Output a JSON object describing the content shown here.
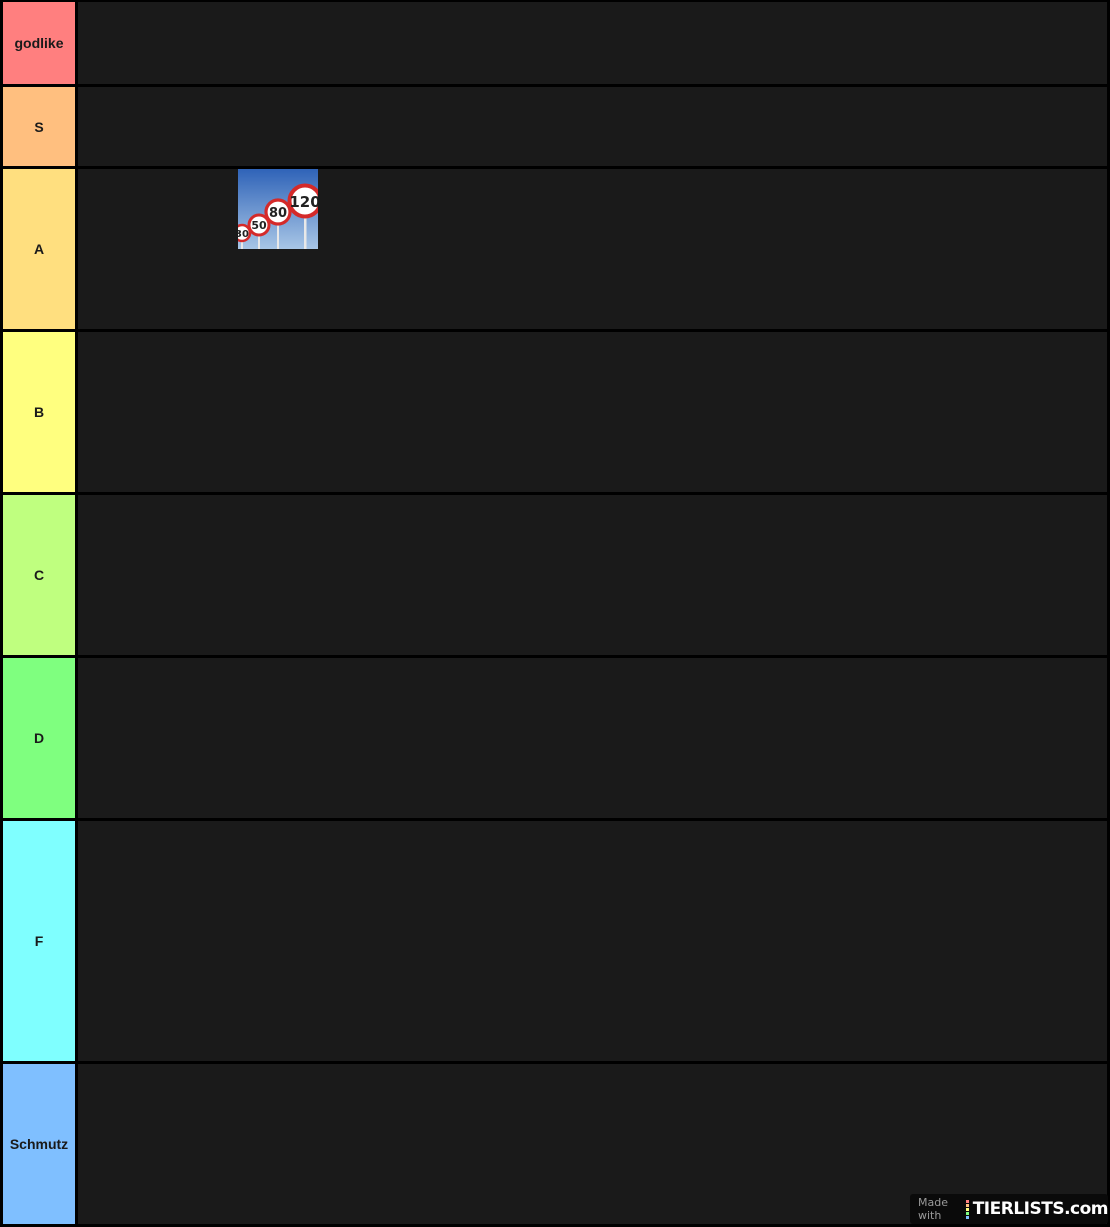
{
  "tiers": [
    {
      "label": "godlike",
      "color": "#ff7f7f"
    },
    {
      "label": "S",
      "color": "#ffbf7f"
    },
    {
      "label": "A",
      "color": "#ffdf7f"
    },
    {
      "label": "B",
      "color": "#ffff7f"
    },
    {
      "label": "C",
      "color": "#bfff7f"
    },
    {
      "label": "D",
      "color": "#7fff7f"
    },
    {
      "label": "F",
      "color": "#7fffff"
    },
    {
      "label": "Schmutz",
      "color": "#7fbfff"
    }
  ],
  "items": [
    {
      "tier": "A",
      "sign_numbers": [
        "30",
        "50",
        "80",
        "120"
      ]
    }
  ],
  "watermark": {
    "made_with": "Made with",
    "brand": "TIERLISTS.com",
    "logo_colors": [
      "#ff7f7f",
      "#ffbf7f",
      "#ffff7f",
      "#7fff7f",
      "#7fbfff"
    ]
  },
  "colors": {
    "row_background": "#1a1a1a",
    "border": "#000000"
  }
}
